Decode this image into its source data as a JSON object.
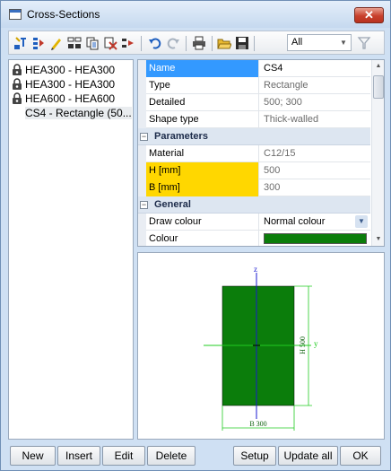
{
  "window": {
    "title": "Cross-Sections",
    "close_label": "✕"
  },
  "toolbar": {
    "icons": [
      "new-section-icon",
      "insert-icon",
      "edit-icon",
      "copy-icon",
      "copy-props-icon",
      "delete-icon",
      "move-icon",
      "undo-icon",
      "redo-icon",
      "print-icon",
      "open-icon",
      "save-icon",
      "filter-icon"
    ],
    "filter": {
      "selected": "All"
    }
  },
  "tree": {
    "items": [
      {
        "label": "HEA300 - HEA300",
        "locked": true
      },
      {
        "label": "HEA300 - HEA300",
        "locked": true
      },
      {
        "label": "HEA600 - HEA600",
        "locked": true
      },
      {
        "label": "CS4 - Rectangle (50...",
        "locked": false
      }
    ]
  },
  "properties": {
    "name": {
      "label": "Name",
      "value": "CS4"
    },
    "type": {
      "label": "Type",
      "value": "Rectangle"
    },
    "detailed": {
      "label": "Detailed",
      "value": "500; 300"
    },
    "shape_type": {
      "label": "Shape type",
      "value": "Thick-walled"
    },
    "parameters_group": {
      "label": "Parameters",
      "toggle": "−"
    },
    "material": {
      "label": "Material",
      "value": "C12/15"
    },
    "h": {
      "label": "H [mm]",
      "value": "500"
    },
    "b": {
      "label": "B [mm]",
      "value": "300"
    },
    "general_group": {
      "label": "General",
      "toggle": "−"
    },
    "draw_colour": {
      "label": "Draw colour",
      "value": "Normal colour"
    },
    "colour": {
      "label": "Colour",
      "value": "#0b7d0b"
    }
  },
  "preview": {
    "z_label": "z",
    "y_label": "y",
    "h_label": "H 500",
    "b_label": "B 300",
    "fill_color": "#0b7d0b"
  },
  "buttons": {
    "new": "New",
    "insert": "Insert",
    "edit": "Edit",
    "delete": "Delete",
    "setup": "Setup",
    "update_all": "Update all",
    "ok": "OK"
  }
}
